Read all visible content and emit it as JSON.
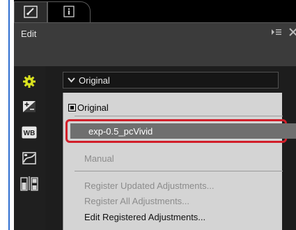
{
  "tabs": [
    {
      "name": "edit",
      "icon": "edit-pencil-icon"
    },
    {
      "name": "info",
      "icon": "info-icon"
    }
  ],
  "panel": {
    "title": "Edit",
    "icons": [
      "panel-menu-icon",
      "close-icon"
    ]
  },
  "sidebar": {
    "items": [
      "gear-icon",
      "exposure-plus-minus-icon",
      "white-balance-icon",
      "tone-curve-icon",
      "before-after-icon"
    ],
    "wb_label": "WB"
  },
  "preset_select": {
    "value": "Original",
    "icon": "chevron-down-icon"
  },
  "menu": {
    "checked_item": "Original",
    "highlighted_item": "exp-0.5_pcVivid",
    "manual": "Manual",
    "register_updated": "Register Updated Adjustments...",
    "register_all": "Register All Adjustments...",
    "edit_registered": "Edit Registered Adjustments..."
  },
  "colors": {
    "highlight_border": "#d21f2a",
    "accent_gear": "#d9e21f",
    "left_rule": "#2f6fd0"
  }
}
